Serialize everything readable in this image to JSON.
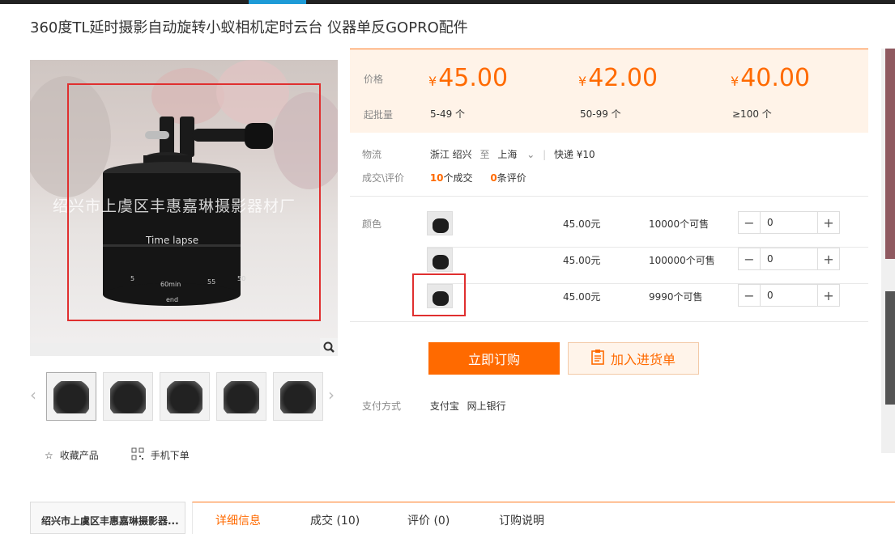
{
  "product": {
    "title": "360度TL延时摄影自动旋转小蚁相机定时云台 仪器单反GOPRO配件",
    "watermark": "绍兴市上虞区丰惠嘉琳摄影器材厂",
    "dial_text": "Time lapse",
    "dial_numbers": [
      "5",
      "60min",
      "55",
      "50"
    ],
    "dial_end": "end"
  },
  "gallery": {
    "thumbnails": [
      "thumb-1",
      "thumb-2",
      "thumb-3",
      "thumb-4",
      "thumb-5"
    ]
  },
  "actions": {
    "favorite": "收藏产品",
    "mobile_order": "手机下单"
  },
  "pricing": {
    "price_label": "价格",
    "moq_label": "起批量",
    "currency": "¥",
    "tiers": [
      {
        "price": "45.00",
        "moq": "5-49 个"
      },
      {
        "price": "42.00",
        "moq": "50-99 个"
      },
      {
        "price": "40.00",
        "moq": "≥100 个"
      }
    ]
  },
  "logistics": {
    "label": "物流",
    "from_province": "浙江",
    "from_city": "绍兴",
    "to_word": "至",
    "to_city": "上海",
    "shipping": "快递 ¥10"
  },
  "trade": {
    "label": "成交\\评价",
    "deals_count": "10",
    "deals_suffix": "个成交",
    "reviews_count": "0",
    "reviews_suffix": "条评价"
  },
  "sku": {
    "color_label": "颜色",
    "rows": [
      {
        "price": "45.00元",
        "stock": "10000个可售",
        "qty": "0"
      },
      {
        "price": "45.00元",
        "stock": "100000个可售",
        "qty": "0"
      },
      {
        "price": "45.00元",
        "stock": "9990个可售",
        "qty": "0"
      }
    ]
  },
  "buttons": {
    "buy_now": "立即订购",
    "add_to_list": "加入进货单"
  },
  "payment": {
    "label": "支付方式",
    "alipay": "支付宝",
    "bank": "网上银行"
  },
  "bottom": {
    "shop_name": "绍兴市上虞区丰惠嘉琳摄影器...",
    "tabs": [
      "详细信息",
      "成交 (10)",
      "评价 (0)",
      "订购说明"
    ]
  },
  "colors": {
    "accent": "#ff6a00",
    "highlight_box": "#e02f2f",
    "price_bg": "#fff3e8"
  }
}
